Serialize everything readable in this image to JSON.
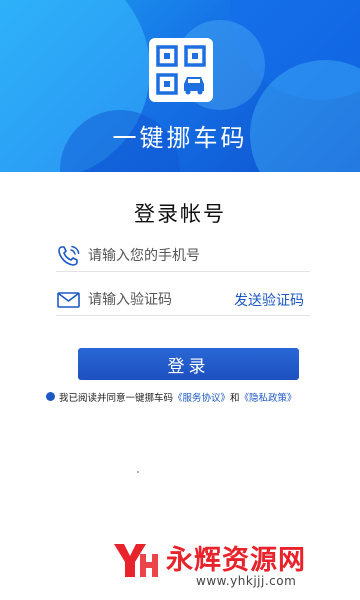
{
  "header": {
    "app_title": "一键挪车码",
    "logo_icon": "qr-car-icon"
  },
  "login": {
    "title": "登录帐号",
    "phone_placeholder": "请输入您的手机号",
    "phone_icon": "phone-call-icon",
    "code_placeholder": "请输入验证码",
    "code_icon": "envelope-icon",
    "send_code_label": "发送验证码",
    "submit_label": "登录"
  },
  "agreement": {
    "prefix": "我已阅读并同意一键挪车码",
    "service_link": "《服务协议》",
    "conjunction": "和",
    "privacy_link": "《隐私政策》"
  },
  "watermark": {
    "brand": "永辉资源网",
    "url": "www.yhkjjj.com"
  },
  "colors": {
    "primary": "#1d58c4",
    "hero_start": "#1fa3f2",
    "hero_end": "#0d4fcf",
    "watermark": "#e8232b"
  }
}
